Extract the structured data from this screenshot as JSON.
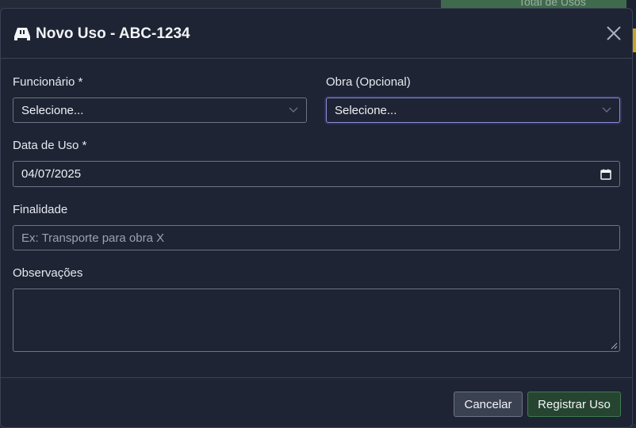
{
  "background": {
    "card_label": "Total de Usos"
  },
  "modal": {
    "title": "Novo Uso - ABC-1234",
    "icon": "car-icon",
    "close_icon": "close-icon",
    "fields": {
      "funcionario": {
        "label": "Funcionário *",
        "value": "Selecione..."
      },
      "obra": {
        "label": "Obra (Opcional)",
        "value": "Selecione..."
      },
      "data_uso": {
        "label": "Data de Uso *",
        "value": "04/07/2025",
        "icon": "calendar-icon"
      },
      "finalidade": {
        "label": "Finalidade",
        "placeholder": "Ex: Transporte para obra X",
        "value": ""
      },
      "observacoes": {
        "label": "Observações",
        "value": ""
      }
    },
    "buttons": {
      "cancel": "Cancelar",
      "submit": "Registrar Uso"
    }
  },
  "colors": {
    "modal_bg": "#1e2433",
    "border": "#6b7385",
    "primary_btn": "#264531",
    "focus_ring": "#8a8fd8"
  }
}
